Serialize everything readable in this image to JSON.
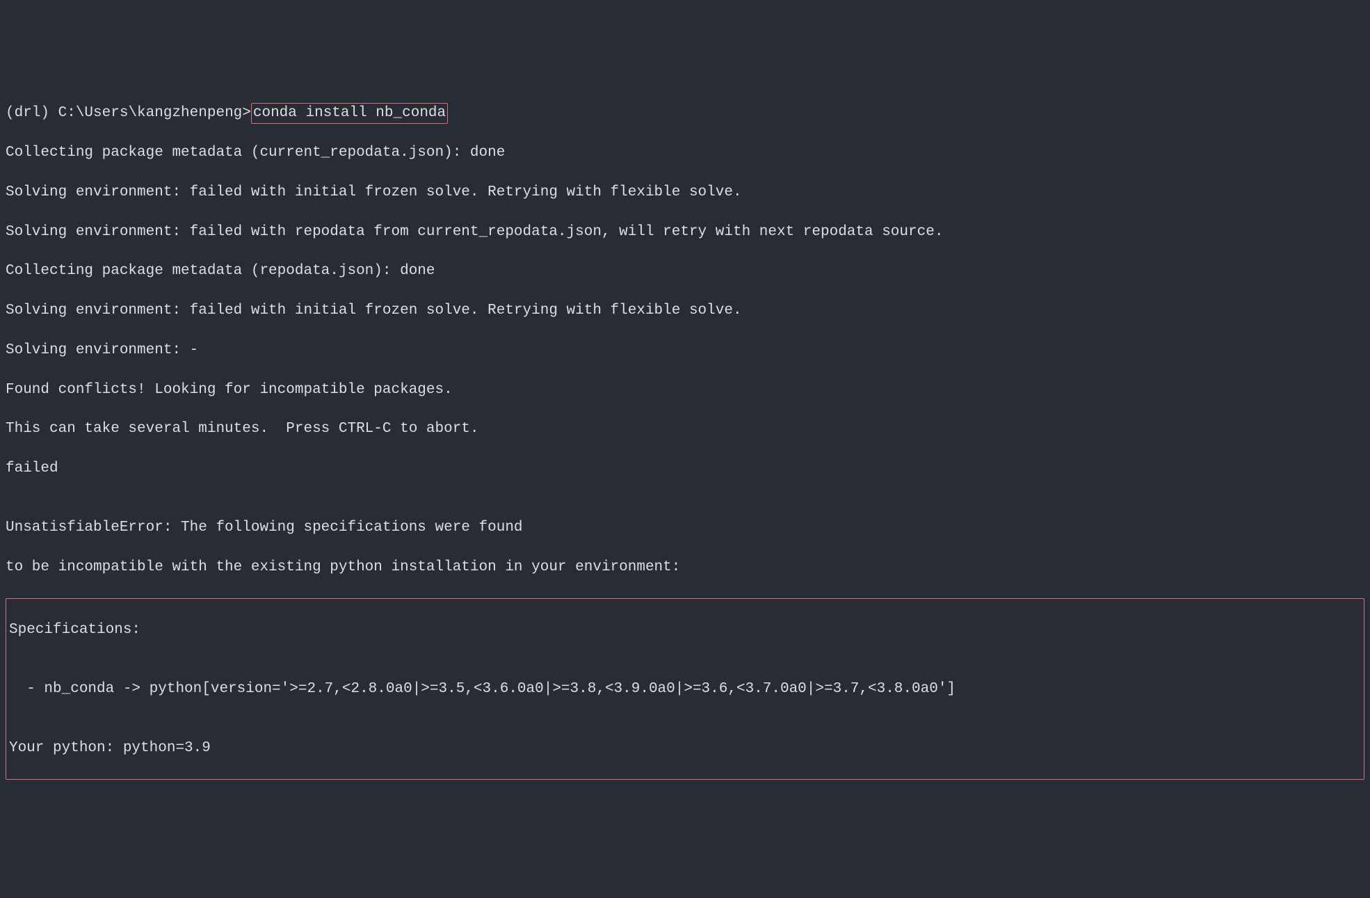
{
  "terminal": {
    "prompt_env": "(drl) ",
    "prompt_path": "C:\\Users\\kangzhenpeng>",
    "command": "conda install nb_conda",
    "output_lines": [
      "Collecting package metadata (current_repodata.json): done",
      "Solving environment: failed with initial frozen solve. Retrying with flexible solve.",
      "Solving environment: failed with repodata from current_repodata.json, will retry with next repodata source.",
      "Collecting package metadata (repodata.json): done",
      "Solving environment: failed with initial frozen solve. Retrying with flexible solve.",
      "Solving environment: -",
      "Found conflicts! Looking for incompatible packages.",
      "This can take several minutes.  Press CTRL-C to abort.",
      "failed",
      "",
      "UnsatisfiableError: The following specifications were found",
      "to be incompatible with the existing python installation in your environment:"
    ],
    "spec_block": {
      "line1": "Specifications:",
      "line2": "",
      "line3": "  - nb_conda -> python[version='>=2.7,<2.8.0a0|>=3.5,<3.6.0a0|>=3.8,<3.9.0a0|>=3.6,<3.7.0a0|>=3.7,<3.8.0a0']",
      "line4": "",
      "line5": "Your python: python=3.9"
    }
  }
}
